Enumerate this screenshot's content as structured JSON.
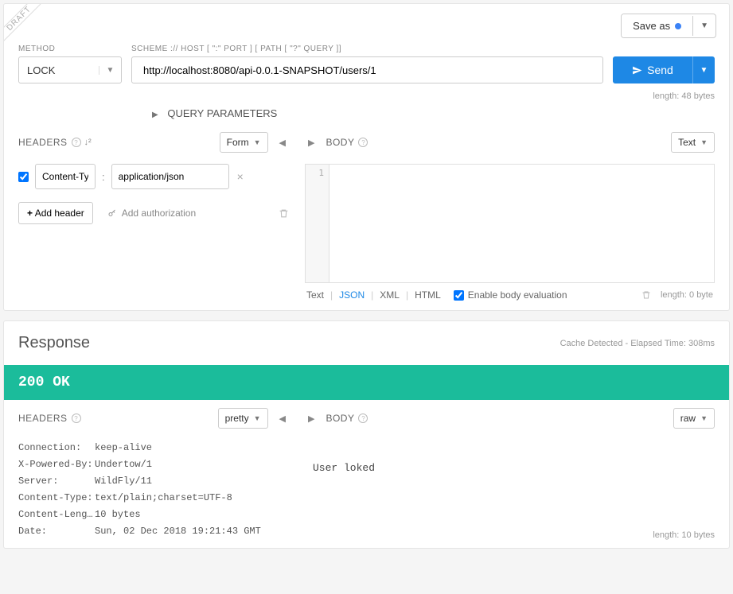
{
  "ribbon": "DRAFT",
  "saveAs": {
    "label": "Save as"
  },
  "labels": {
    "method": "METHOD",
    "scheme": "SCHEME :// HOST [ \":\" PORT ] [ PATH [ \"?\" QUERY ]]"
  },
  "request": {
    "method": "LOCK",
    "url": "http://localhost:8080/api-0.0.1-SNAPSHOT/users/1",
    "lengthNote": "length: 48 bytes",
    "send": "Send",
    "queryParams": "QUERY PARAMETERS"
  },
  "reqHeaders": {
    "title": "HEADERS",
    "mode": "Form",
    "items": [
      {
        "enabled": true,
        "name": "Content-Type",
        "value": "application/json"
      }
    ],
    "addHeader": "Add header",
    "addAuth": "Add authorization"
  },
  "reqBody": {
    "title": "BODY",
    "mode": "Text",
    "gutter": "1",
    "formats": {
      "text": "Text",
      "json": "JSON",
      "xml": "XML",
      "html": "HTML"
    },
    "enableEval": "Enable body evaluation",
    "lengthNote": "length: 0 byte"
  },
  "response": {
    "title": "Response",
    "meta": "Cache Detected - Elapsed Time: 308ms",
    "status": "200  OK"
  },
  "respHeaders": {
    "title": "HEADERS",
    "mode": "pretty",
    "items": [
      {
        "k": "Connection:",
        "v": "keep-alive"
      },
      {
        "k": "X-Powered-By:",
        "v": "Undertow/1"
      },
      {
        "k": "Server:",
        "v": "WildFly/11"
      },
      {
        "k": "Content-Type:",
        "v": "text/plain;charset=UTF-8"
      },
      {
        "k": "Content-Leng…",
        "v": "10 bytes"
      },
      {
        "k": "Date:",
        "v": "Sun, 02 Dec 2018 19:21:43 GMT"
      }
    ]
  },
  "respBody": {
    "title": "BODY",
    "mode": "raw",
    "text": "User loked",
    "lengthNote": "length: 10 bytes"
  }
}
